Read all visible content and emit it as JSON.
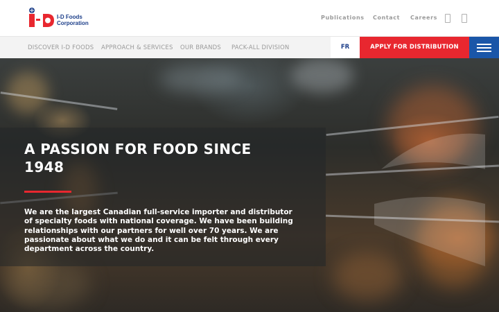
{
  "brand": {
    "logo_line1": "I-D Foods",
    "logo_line2": "Corporation",
    "logo_mark": "i·d",
    "primary_color": "#1d3f8a",
    "accent_color": "#e8272f"
  },
  "utility_nav": {
    "links": [
      "Publications",
      "Contact",
      "Careers"
    ],
    "icons": [
      "linkedin-icon",
      "facebook-icon"
    ]
  },
  "main_nav": {
    "items": [
      "DISCOVER I-D FOODS",
      "APPROACH & SERVICES",
      "OUR BRANDS",
      "PACK-ALL DIVISION"
    ],
    "language_label": "FR",
    "cta_label": "APPLY FOR DISTRIBUTION",
    "menu_icon": "hamburger-menu-icon",
    "menu_color": "#1a56a8"
  },
  "hero": {
    "title": "A PASSION FOR FOOD SINCE 1948",
    "body": "We are the largest Canadian full-service importer and distributor of specialty foods with national coverage. We have been building relationships with our partners for well over 70 years. We are passionate about what we do and it can be felt through every department across the country."
  }
}
